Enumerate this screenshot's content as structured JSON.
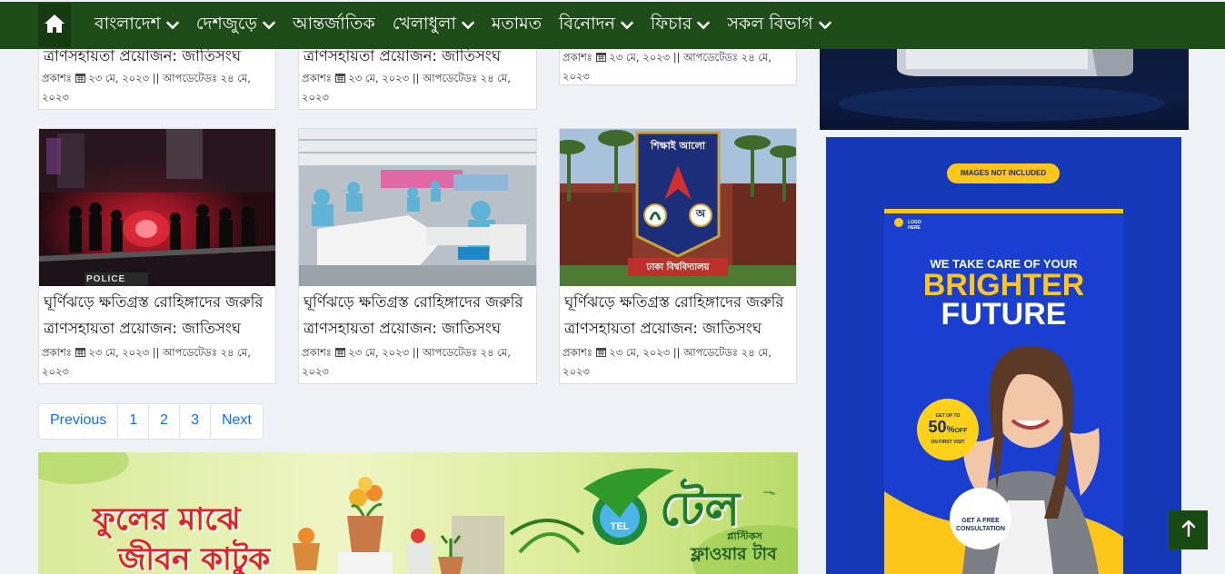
{
  "nav": {
    "items": [
      {
        "label": "বাংলাদেশ",
        "dropdown": true
      },
      {
        "label": "দেশজুড়ে",
        "dropdown": true
      },
      {
        "label": "আন্তর্জাতিক",
        "dropdown": false
      },
      {
        "label": "খেলাধুলা",
        "dropdown": true
      },
      {
        "label": "মতামত",
        "dropdown": false
      },
      {
        "label": "বিনোদন",
        "dropdown": true
      },
      {
        "label": "ফিচার",
        "dropdown": true
      },
      {
        "label": "সকল বিভাগ",
        "dropdown": true
      }
    ],
    "home_icon": "home-icon",
    "bg_color": "#1f4d19"
  },
  "top_cards": [
    {
      "title_tail": "ত্রাণসহায়তা প্রয়োজন: জাতিসংঘ",
      "published_label": "প্রকাশঃ",
      "published_date": "২৩ মে, ২০২৩",
      "separator": "||",
      "updated_label": "আপডেটেডঃ",
      "updated_date": "২৪ মে, ২০২৩"
    },
    {
      "title_tail": "ত্রাণসহায়তা প্রয়োজন: জাতিসংঘ",
      "published_label": "প্রকাশঃ",
      "published_date": "২৩ মে, ২০২৩",
      "separator": "||",
      "updated_label": "আপডেটেডঃ",
      "updated_date": "২৪ মে, ২০২৩"
    },
    {
      "title_tail": "",
      "published_label": "প্রকাশঃ",
      "published_date": "২৩ মে, ২০২৩",
      "separator": "||",
      "updated_label": "আপডেটেডঃ",
      "updated_date": "২৪ মে, ২০২৩"
    }
  ],
  "cards": [
    {
      "title": "ঘূর্ণিঝড়ে ক্ষতিগ্রস্ত রোহিঙ্গাদের জরুরি ত্রাণসহায়তা প্রয়োজন: জাতিসংঘ",
      "published_label": "প্রকাশঃ",
      "published_date": "২৩ মে, ২০২৩",
      "separator": "||",
      "updated_label": "আপডেটেডঃ",
      "updated_date": "২৪ মে, ২০২৩",
      "image": "police-night-scene"
    },
    {
      "title": "ঘূর্ণিঝড়ে ক্ষতিগ্রস্ত রোহিঙ্গাদের জরুরি ত্রাণসহায়তা প্রয়োজন: জাতিসংঘ",
      "published_label": "প্রকাশঃ",
      "published_date": "২৩ মে, ২০২৩",
      "separator": "||",
      "updated_label": "আপডেটেডঃ",
      "updated_date": "২৪ মে, ২০২৩",
      "image": "garment-factory"
    },
    {
      "title": "ঘূর্ণিঝড়ে ক্ষতিগ্রস্ত রোহিঙ্গাদের জরুরি ত্রাণসহায়তা প্রয়োজন: জাতিসংঘ",
      "published_label": "প্রকাশঃ",
      "published_date": "২৩ মে, ২০২৩",
      "separator": "||",
      "updated_label": "আপডেটেডঃ",
      "updated_date": "২৪ মে, ২০২৩",
      "image": "dhaka-university-logo"
    }
  ],
  "card_images": {
    "police_sign": "POLICE",
    "du_seal_top": "শিক্ষাই আলো",
    "du_seal_bottom": "ঢাকা বিশ্ববিদ্যালয়",
    "du_seal_letter": "অ"
  },
  "pagination": {
    "previous": "Previous",
    "pages": [
      "1",
      "2",
      "3"
    ],
    "next": "Next",
    "link_color": "#0d6efd"
  },
  "banner": {
    "slogan_line1": "ফুলের মাঝে",
    "slogan_line2": "জীবন কাটুক",
    "brand_name": "টেল",
    "brand_badge": "TEL",
    "brand_sub": "প্লাস্টিকস",
    "product": "ফ্লাওয়ার টাব",
    "tm": "™"
  },
  "side_ad": {
    "badge": "IMAGES NOT INCLUDED",
    "logo": "LOGO HERE",
    "headline1": "WE TAKE CARE OF YOUR",
    "headline2": "BRIGHTER",
    "headline3": "FUTURE",
    "offer_top": "GET UP TO",
    "offer_value": "50",
    "offer_pct": "%",
    "offer_off": "OFF",
    "offer_bottom": "ON FIRST VISIT",
    "cta": "GET A FREE CONSULTATION",
    "accent": "#ffc61a",
    "bg": "#1538b8"
  },
  "back_to_top_icon": "arrow-up-icon"
}
